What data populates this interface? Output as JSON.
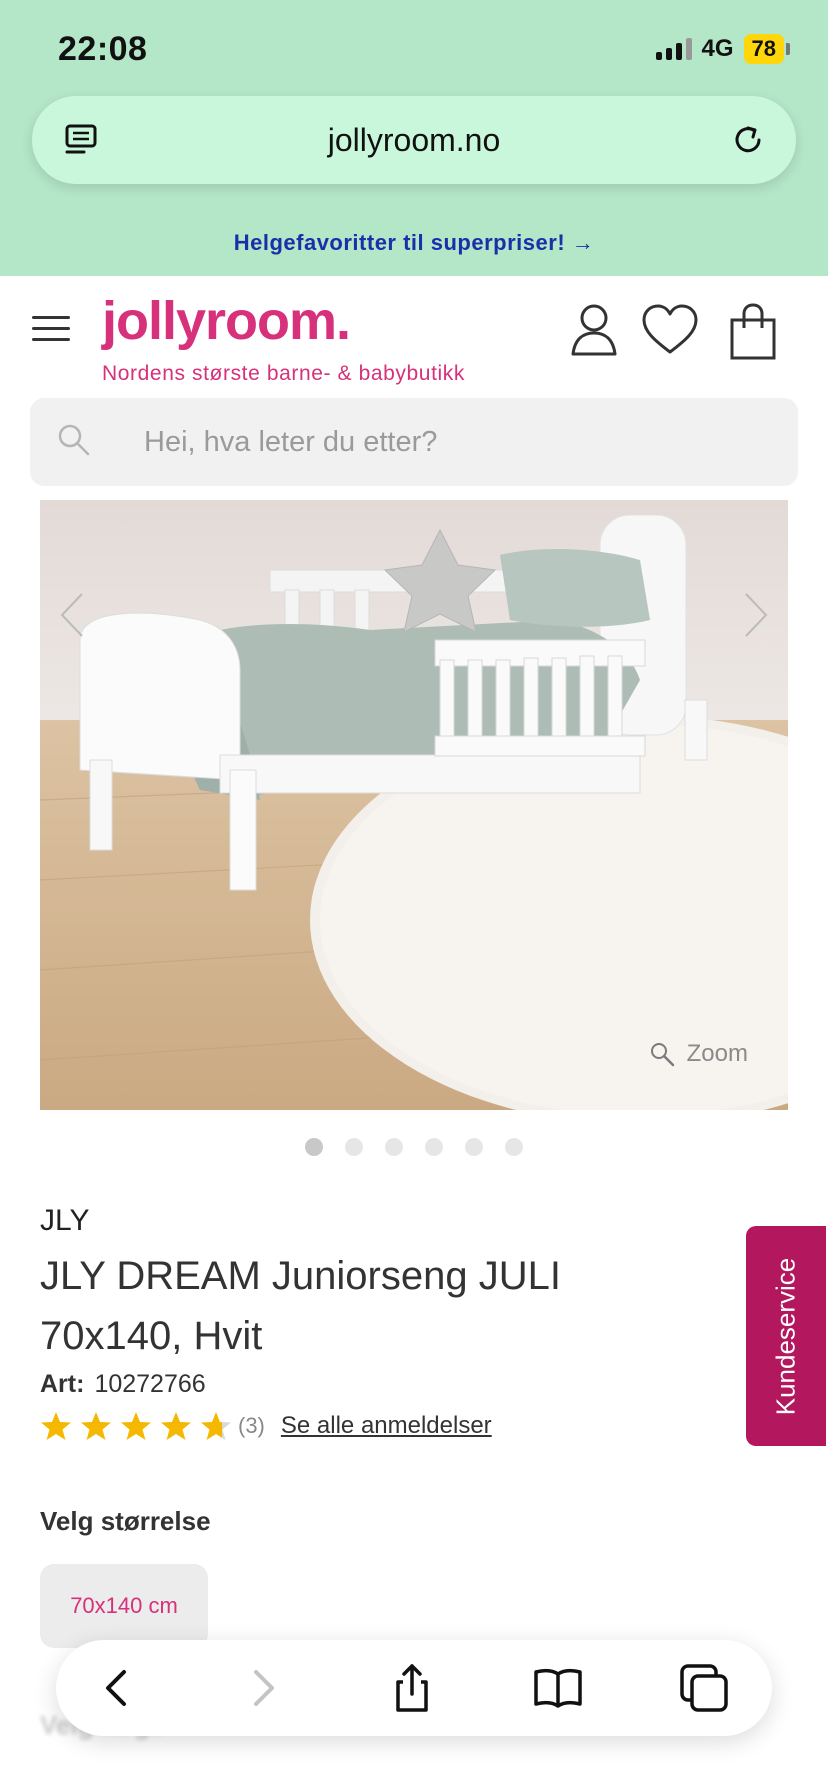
{
  "status": {
    "time": "22:08",
    "network": "4G",
    "battery": "78"
  },
  "browser": {
    "url": "jollyroom.no"
  },
  "promo": "Helgefavoritter til superpriser! →",
  "site": {
    "logo": "jollyroom.",
    "tagline": "Nordens største barne- & babybutikk"
  },
  "search": {
    "placeholder": "Hei, hva leter du etter?"
  },
  "image": {
    "zoom_label": "Zoom",
    "slide_count": 6,
    "active_slide": 1
  },
  "product": {
    "brand": "JLY",
    "title": "JLY DREAM Juniorseng JULI 70x140, Hvit",
    "art_label": "Art:",
    "art_number": "10272766",
    "rating": 4.7,
    "review_count": "(3)",
    "reviews_link": "Se alle anmeldelser",
    "size_label": "Velg størrelse",
    "selected_size": "70x140 cm",
    "next_section_label": "Velg farge"
  },
  "kundeservice": "Kundeservice",
  "colors": {
    "brand_pink": "#d6317a",
    "service_tab": "#b3185f",
    "browser_bg": "#b4e6c8",
    "promo_blue": "#1b2fa8",
    "star": "#f5b800"
  },
  "icons": {
    "url_left": "reader-icon",
    "url_right": "reload-icon",
    "header": [
      "user-icon",
      "heart-icon",
      "shopping-bag-icon"
    ],
    "nav": [
      "back-icon",
      "forward-icon",
      "share-icon",
      "bookmarks-icon",
      "tabs-icon"
    ]
  }
}
